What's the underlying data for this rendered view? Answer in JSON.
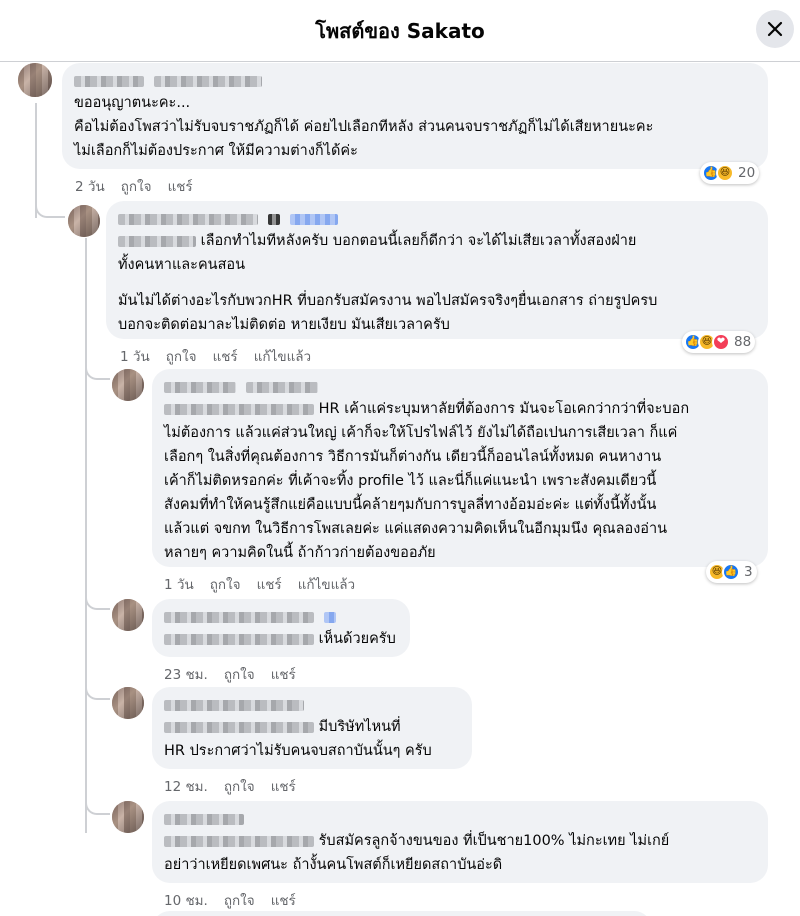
{
  "header": {
    "title": "โพสต์ของ Sakato",
    "close_icon": "close-icon"
  },
  "colors": {
    "bubble": "#f0f2f5",
    "meta": "#65676b",
    "like": "#1877f2",
    "haha": "#f7b928",
    "love": "#f33e58"
  },
  "comments": [
    {
      "lines": [
        "ขออนุญาตนะคะ...",
        "คือไม่ต้องโพสว่าไม่รับจบราชภัฏก็ได้ ค่อยไปเลือกทีหลัง ส่วนคนจบราชภัฏก็ไม่ได้เสียหายนะคะ",
        "ไม่เลือกก็ไม่ต้องประกาศ ให้มีความต่างก็ได้ค่ะ"
      ],
      "time": "2 วัน",
      "like": "ถูกใจ",
      "reply": "แชร์",
      "reactions": [
        "like",
        "haha"
      ],
      "reaction_count": "20"
    },
    {
      "lines_a": [
        "เลือกทำไมทีหลังครับ บอกตอนนี้เลยก็ดีกว่า จะได้ไม่เสียเวลาทั้งสองฝ่าย",
        "ทั้งคนหาและคนสอน"
      ],
      "lines_b": [
        "มันไม่ได้ต่างอะไรกับพวกHR ที่บอกรับสมัครงาน พอไปสมัครจริงๆยื่นเอกสาร ถ่ายรูปครบ",
        "บอกจะติดต่อมาละไม่ติดต่อ หายเงียบ มันเสียเวลาครับ"
      ],
      "time": "1 วัน",
      "like": "ถูกใจ",
      "reply": "แชร์",
      "edited": "แก้ไขแล้ว",
      "reactions": [
        "like",
        "haha",
        "love"
      ],
      "reaction_count": "88"
    },
    {
      "lines": [
        "HR เค้าแค่ระบุมหาลัยที่ต้องการ มันจะโอเคกว่ากว่าที่จะบอก",
        "ไม่ต้องการ แล้วแค่ส่วนใหญ่ เค้าก็จะให้โปรไฟล์ไว้ ยังไม่ได้ถือเปนการเสียเวลา ก็แค่",
        "เลือกๆ ในสิ่งที่คุณต้องการ วิธีการมันก็ต่างกัน เดียวนี้ก็ออนไลน์ทั้งหมด คนหางาน",
        "เค้าก็ไม่ติดหรอกค่ะ ที่เค้าจะทิ้ง profile ไว้ และนี่ก็แค่แนะนำ เพราะสังคมเดียวนี้",
        "สังคมที่ทำให้คนรู้สึกแย่คือแบบนี้คล้ายๆมกับการบูลลี่ทางอ้อมอ่ะค่ะ แต่ทั้งนี้ทั้งนั้น",
        "แล้วแต่ จขกท ในวิธีการโพสเลยค่ะ แค่แสดงความคิดเห็นในอีกมุมนึง คุณลองอ่าน",
        "หลายๆ ความคิดในนี้ ถ้าก้าวก่ายต้องขออภัย"
      ],
      "time": "1 วัน",
      "like": "ถูกใจ",
      "reply": "แชร์",
      "edited": "แก้ไขแล้ว",
      "reactions": [
        "haha",
        "like"
      ],
      "reaction_count": "3"
    },
    {
      "lines": [
        "เห็นด้วยครับ"
      ],
      "time": "23 ชม.",
      "like": "ถูกใจ",
      "reply": "แชร์"
    },
    {
      "lines": [
        "มีบริษัทไหนที่",
        "HR ประกาศว่าไม่รับคนจบสถาบันนั้นๆ ครับ"
      ],
      "time": "12 ชม.",
      "like": "ถูกใจ",
      "reply": "แชร์"
    },
    {
      "lines": [
        "รับสมัครลูกจ้างขนของ ที่เป็นชาย100% ไม่กะเทย ไม่เกย์",
        "อย่าว่าเหยียดเพศนะ ถ้างั้นคนโพสต์ก็เหยียดสถาบันอ่ะดิ"
      ],
      "time": "10 ชม.",
      "like": "ถูกใจ",
      "reply": "แชร์"
    }
  ]
}
